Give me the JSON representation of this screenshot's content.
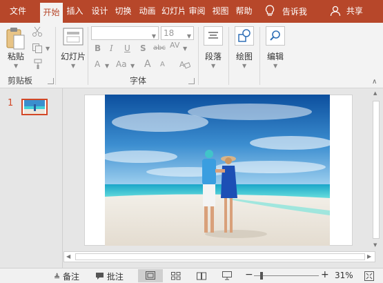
{
  "tabs": [
    {
      "label": "文件",
      "active": false
    },
    {
      "label": "开始",
      "active": true
    },
    {
      "label": "插入",
      "active": false
    },
    {
      "label": "设计",
      "active": false
    },
    {
      "label": "切换",
      "active": false
    },
    {
      "label": "动画",
      "active": false
    },
    {
      "label": "幻灯片放映",
      "active": false
    },
    {
      "label": "审阅",
      "active": false
    },
    {
      "label": "视图",
      "active": false
    },
    {
      "label": "帮助",
      "active": false
    }
  ],
  "tellme": {
    "icon": "lightbulb-icon",
    "label": "告诉我"
  },
  "share": {
    "icon": "person-icon",
    "label": "共享"
  },
  "ribbon": {
    "clipboard": {
      "paste_label": "粘贴",
      "group_label": "剪贴板"
    },
    "slides": {
      "new_slide_label": "幻灯片"
    },
    "font": {
      "font_name_value": "",
      "font_size_value": "18",
      "group_label": "字体"
    },
    "paragraph": {
      "label": "段落"
    },
    "drawing": {
      "label": "绘图"
    },
    "editing": {
      "label": "编辑"
    }
  },
  "thumbnails": [
    {
      "number": "1",
      "selected": true
    }
  ],
  "statusbar": {
    "notes_label": "备注",
    "comments_label": "批注",
    "zoom_minus": "−",
    "zoom_plus": "+",
    "zoom_value": "31%"
  },
  "colors": {
    "brand": "#b7472a",
    "ribbon_bg": "#f3f3f3",
    "canvas_bg": "#e6e6e6",
    "selected_thumb": "#d24726"
  }
}
